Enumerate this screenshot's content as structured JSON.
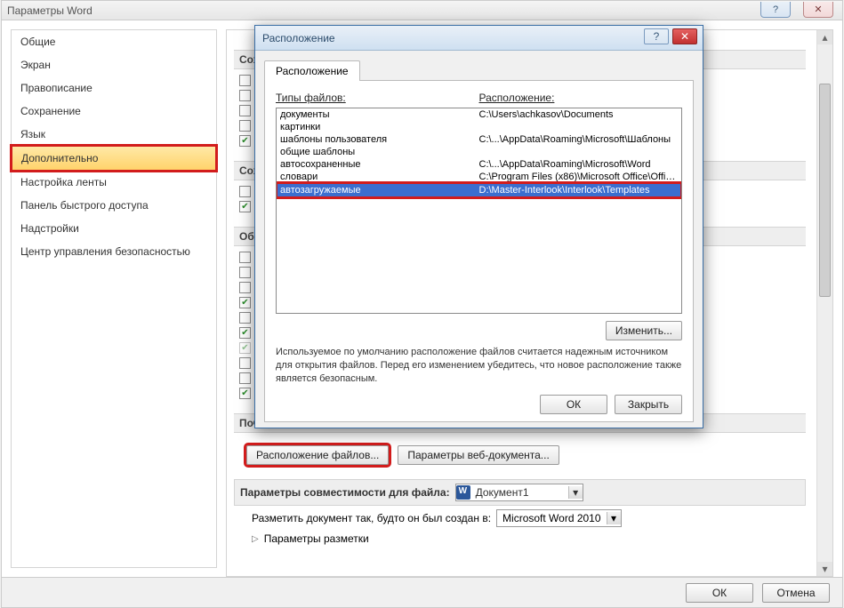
{
  "outer": {
    "title": "Параметры Word",
    "sidebar": {
      "items": [
        {
          "label": "Общие"
        },
        {
          "label": "Экран"
        },
        {
          "label": "Правописание"
        },
        {
          "label": "Сохранение"
        },
        {
          "label": "Язык"
        },
        {
          "label": "Дополнительно",
          "selected": true
        },
        {
          "label": "Настройка ленты"
        },
        {
          "label": "Панель быстрого доступа"
        },
        {
          "label": "Надстройки"
        },
        {
          "label": "Центр управления безопасностью"
        }
      ]
    },
    "content": {
      "sections": [
        {
          "header": "Сохр",
          "checks": [
            false,
            false,
            false,
            false,
            true
          ]
        },
        {
          "header": "Сохр",
          "checks": [
            false,
            true
          ]
        },
        {
          "header": "Общи",
          "checks": [
            false,
            false,
            false,
            true,
            false,
            true,
            false,
            false,
            false,
            true
          ]
        },
        {
          "header": "Почт"
        }
      ],
      "btn_file_locations": "Расположение файлов...",
      "btn_web_options": "Параметры веб-документа...",
      "compat_label": "Параметры совместимости для файла:",
      "compat_doc": "Документ1",
      "layout_label": "Разметить документ так, будто он был создан в:",
      "layout_value": "Microsoft Word 2010",
      "layout_params": "Параметры разметки"
    },
    "footer": {
      "ok": "ОК",
      "cancel": "Отмена"
    }
  },
  "dialog": {
    "title": "Расположение",
    "tab": "Расположение",
    "col_types": "Типы файлов:",
    "col_paths": "Расположение:",
    "rows": [
      {
        "type": "документы",
        "path": "C:\\Users\\achkasov\\Documents"
      },
      {
        "type": "картинки",
        "path": ""
      },
      {
        "type": "шаблоны пользователя",
        "path": "C:\\...\\AppData\\Roaming\\Microsoft\\Шаблоны"
      },
      {
        "type": "общие шаблоны",
        "path": ""
      },
      {
        "type": "автосохраненные",
        "path": "C:\\...\\AppData\\Roaming\\Microsoft\\Word"
      },
      {
        "type": "словари",
        "path": "C:\\Program Files (x86)\\Microsoft Office\\Offic..."
      },
      {
        "type": "автозагружаемые",
        "path": "D:\\Master-Interlook\\Interlook\\Templates",
        "selected": true
      }
    ],
    "modify": "Изменить...",
    "note": "Используемое по умолчанию расположение файлов считается надежным источником для открытия файлов. Перед его изменением убедитесь, что новое расположение также является безопасным.",
    "ok": "ОК",
    "close": "Закрыть"
  }
}
